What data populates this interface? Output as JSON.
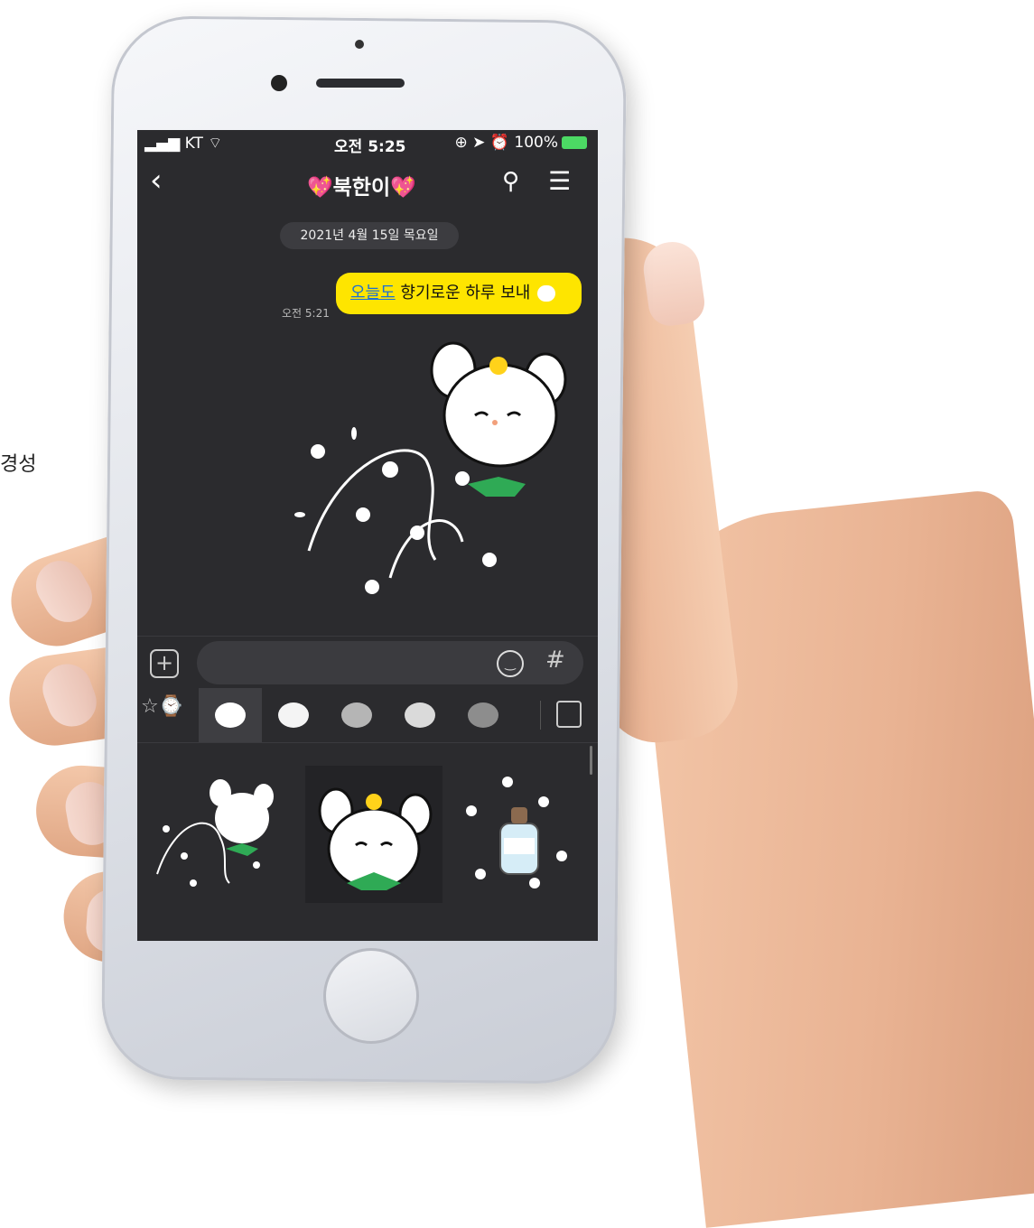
{
  "side_text": "경성",
  "status_bar": {
    "carrier": "KT",
    "time": "오전 5:25",
    "battery": "100%"
  },
  "header": {
    "back": "‹",
    "title": "💖북한이💖",
    "search_icon": "search-icon",
    "menu_icon": "menu-icon"
  },
  "date_divider": "2021년 4월 15일 목요일",
  "message": {
    "highlight": "오늘도",
    "rest": " 향기로운 하루 보내",
    "time": "오전 5:21"
  },
  "input": {
    "plus": "+",
    "hash": "#"
  },
  "emoticon_tabs": [
    "recent",
    "bunny-flower",
    "bunny-plain",
    "cat-gray",
    "cat-white",
    "girl"
  ],
  "colors": {
    "bubble": "#fee500",
    "screen_bg": "#2b2b2e",
    "link": "#1a6fd6"
  }
}
